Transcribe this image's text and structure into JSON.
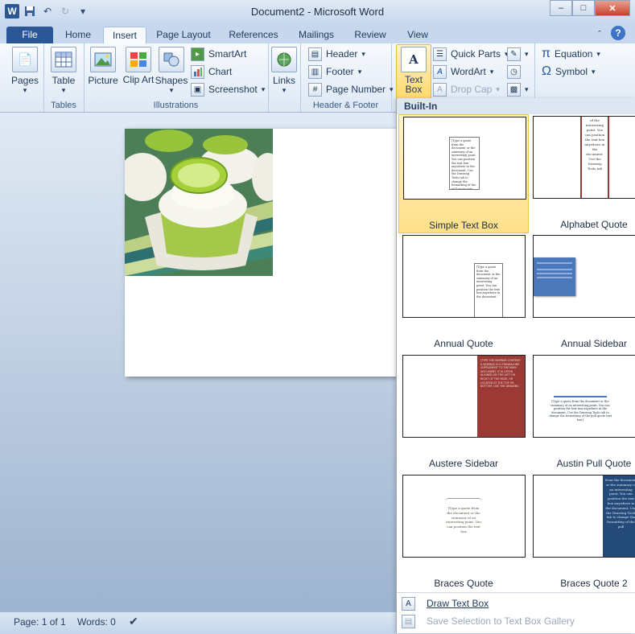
{
  "window": {
    "title": "Document2 - Microsoft Word"
  },
  "qat": {
    "icons": [
      "word-app-icon",
      "save-icon",
      "undo-icon",
      "redo-icon",
      "customize-icon"
    ]
  },
  "tabs": [
    "File",
    "Home",
    "Insert",
    "Page Layout",
    "References",
    "Mailings",
    "Review",
    "View"
  ],
  "ribbon": {
    "pages": {
      "label": "Pages"
    },
    "tables": {
      "button": "Table",
      "group": "Tables"
    },
    "illustrations": {
      "picture": "Picture",
      "clipart": "Clip Art",
      "shapes": "Shapes",
      "smartart": "SmartArt",
      "chart": "Chart",
      "screenshot": "Screenshot",
      "group": "Illustrations"
    },
    "links": {
      "label": "Links"
    },
    "header_footer": {
      "header": "Header",
      "footer": "Footer",
      "page_number": "Page Number",
      "group": "Header & Footer"
    },
    "text": {
      "text_box": "Text Box",
      "quick_parts": "Quick Parts",
      "wordart": "WordArt",
      "drop_cap": "Drop Cap"
    },
    "symbols": {
      "equation": "Equation",
      "symbol": "Symbol"
    }
  },
  "gallery": {
    "section": "Built-In",
    "items": [
      {
        "label": "Simple Text Box",
        "selected": true
      },
      {
        "label": "Alphabet Quote"
      },
      {
        "label": "Annual Quote"
      },
      {
        "label": "Annual Sidebar"
      },
      {
        "label": "Austere Sidebar"
      },
      {
        "label": "Austin Pull Quote"
      },
      {
        "label": "Braces Quote"
      },
      {
        "label": "Braces Quote 2"
      }
    ],
    "thumb_text": {
      "simple": "[Type a quote from the document or the summary of an interesting point. You can position the text box anywhere in the document. Use the Drawing Tools tab to change the formatting of the pull quote text box.]",
      "alphabet": "of the interesting point. You can position the text box anywhere in the document. Use the Drawing Tools tab",
      "annual": "[Type a quote from the document or the summary of an interesting point. You can position the text box anywhere in the document.",
      "austere": "[TYPE THE SIDEBAR CONTENT. A SIDEBAR IS A STANDALONE SUPPLEMENT TO THE MAIN DOCUMENT. IT IS OFTEN ALIGNED ON THE LEFT OR RIGHT OF THE PAGE, OR LOCATED AT THE TOP OR BOTTOM. USE THE DRAWING",
      "austin": "[Type a quote from the document or the summary of an interesting point. You can position the text box anywhere in the document. Use the Drawing Tools tab to change the formatting of the pull quote text box.]",
      "braces": "[Type a quote from the document or the summary of an interesting point. You can position the text box",
      "braces2": "from the document or the summary of an interesting point. You can position the text box anywhere in the document. Use the Drawing Tools tab to change the formatting of the pull"
    },
    "draw_text_box": "Draw Text Box",
    "save_selection": "Save Selection to Text Box Gallery"
  },
  "status": {
    "page": "Page: 1 of 1",
    "words": "Words: 0"
  },
  "colors": {
    "accent": "#2b5797",
    "austere": "#9b3a35",
    "sidebar_blue": "#4a78b8",
    "braces2": "#244a7a",
    "selected": "#ffe08a"
  }
}
